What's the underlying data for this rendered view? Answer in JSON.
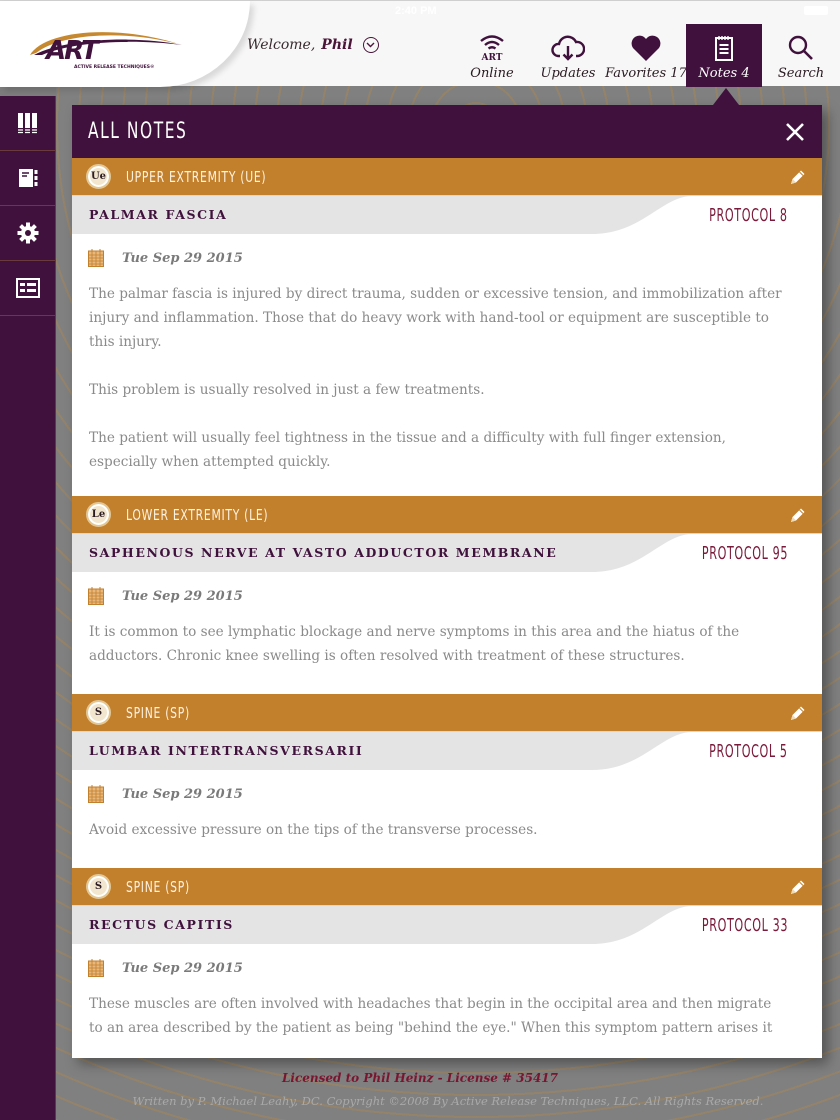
{
  "status_bar": {
    "time": "2:40 PM"
  },
  "header": {
    "logo_text": "ART",
    "logo_subtitle": "ACTIVE RELEASE TECHNIQUES®",
    "welcome_prefix": "Welcome,",
    "user_name": "Phil",
    "nav": [
      {
        "id": "online",
        "icon": "wifi-art-icon",
        "icon_text": "ART",
        "label": "Online",
        "active": false
      },
      {
        "id": "updates",
        "icon": "cloud-download-icon",
        "label": "Updates",
        "active": false
      },
      {
        "id": "favorites",
        "icon": "heart-icon",
        "label": "Favorites 17",
        "active": false
      },
      {
        "id": "notes",
        "icon": "notepad-icon",
        "label": "Notes 4",
        "active": true
      },
      {
        "id": "search",
        "icon": "search-icon",
        "label": "Search",
        "active": false
      }
    ]
  },
  "sidebar": {
    "items": [
      {
        "icon": "books-icon"
      },
      {
        "icon": "notebook-icon"
      },
      {
        "icon": "gear-icon"
      },
      {
        "icon": "form-list-icon"
      }
    ]
  },
  "panel": {
    "title": "ALL NOTES",
    "notes": [
      {
        "category_badge": "Ue",
        "category": "UPPER EXTREMITY (UE)",
        "title": "PALMAR FASCIA",
        "protocol": "PROTOCOL 8",
        "date": "Tue Sep 29 2015",
        "paragraphs": [
          "The palmar fascia is injured by direct trauma, sudden or excessive tension, and immobilization after injury and inflammation. Those that do heavy work with hand-tool or equipment are susceptible to this injury.",
          "This problem is usually resolved in just a few treatments.",
          "The patient will usually feel tightness in the tissue and a difficulty with full finger extension, especially when attempted quickly."
        ]
      },
      {
        "category_badge": "Le",
        "category": "LOWER EXTREMITY (LE)",
        "title": "SAPHENOUS NERVE AT VASTO ADDUCTOR MEMBRANE",
        "protocol": "PROTOCOL 95",
        "date": "Tue Sep 29 2015",
        "paragraphs": [
          "It is common to see lymphatic blockage and nerve symptoms in this area and the hiatus of the adductors. Chronic knee swelling is often resolved with treatment of these structures."
        ]
      },
      {
        "category_badge": "S",
        "category": "SPINE (SP)",
        "title": "LUMBAR INTERTRANSVERSARII",
        "protocol": "PROTOCOL 5",
        "date": "Tue Sep 29 2015",
        "paragraphs": [
          "Avoid excessive pressure on the tips of the transverse processes."
        ]
      },
      {
        "category_badge": "S",
        "category": "SPINE (SP)",
        "title": "RECTUS CAPITIS",
        "protocol": "PROTOCOL 33",
        "date": "Tue Sep 29 2015",
        "paragraphs": [
          "These muscles are often involved with headaches that begin in the occipital area and then migrate to an area described by the patient as being \"behind the eye.\" When this symptom pattern arises it"
        ]
      }
    ]
  },
  "footer": {
    "license": "Licensed to Phil Heinz - License # 35417",
    "copyright": "Written by P. Michael Leahy, DC. Copyright ©2008 By Active Release Techniques, LLC. All Rights Reserved."
  },
  "colors": {
    "brand_purple": "#40113c",
    "category_orange": "#c27f2c",
    "protocol_red": "#7a1a3a"
  }
}
